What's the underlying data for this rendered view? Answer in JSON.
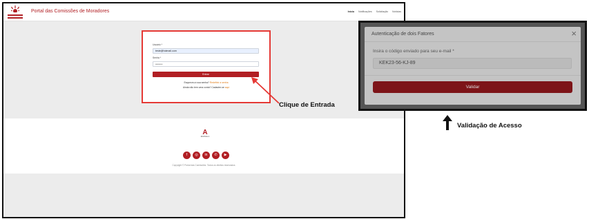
{
  "left_screen": {
    "header": {
      "brand": "Portal das Comissões de Moradores",
      "nav": [
        "Início",
        "Notificações",
        "Solicitação",
        "Notícias"
      ]
    },
    "login": {
      "user_label": "Usuário *",
      "user_value": "teste@hotmail.com",
      "password_label": "Senha *",
      "password_value": "••••••••••",
      "submit_label": "Entrar",
      "forgot_text": "Esqueceu a sua senha?",
      "forgot_link": "Redefinir a senha",
      "account_text": "Ainda não tem uma conta? Cadastre-se",
      "account_link": "aqui"
    },
    "footer": {
      "logo_letter": "A",
      "logo_caption": "EMOMALA",
      "social_icons": [
        "facebook-icon",
        "instagram-icon",
        "linkedin-icon",
        "whatsapp-icon",
        "youtube-icon"
      ],
      "copyright": "Copyright © Portal das Comissões. Todos os direitos reservados"
    }
  },
  "annotations": {
    "left": "Clique de Entrada",
    "right": "Validação de Acesso"
  },
  "two_factor_modal": {
    "title": "Autenticação de dois Fatores",
    "code_label": "Insira o código enviado para seu e-mail *",
    "code_value": "KEK23-56-KJ-89",
    "submit_label": "Validar"
  },
  "colors": {
    "brand_red": "#b11f24",
    "highlight_red": "#e53935",
    "link_orange": "#e07b15"
  }
}
